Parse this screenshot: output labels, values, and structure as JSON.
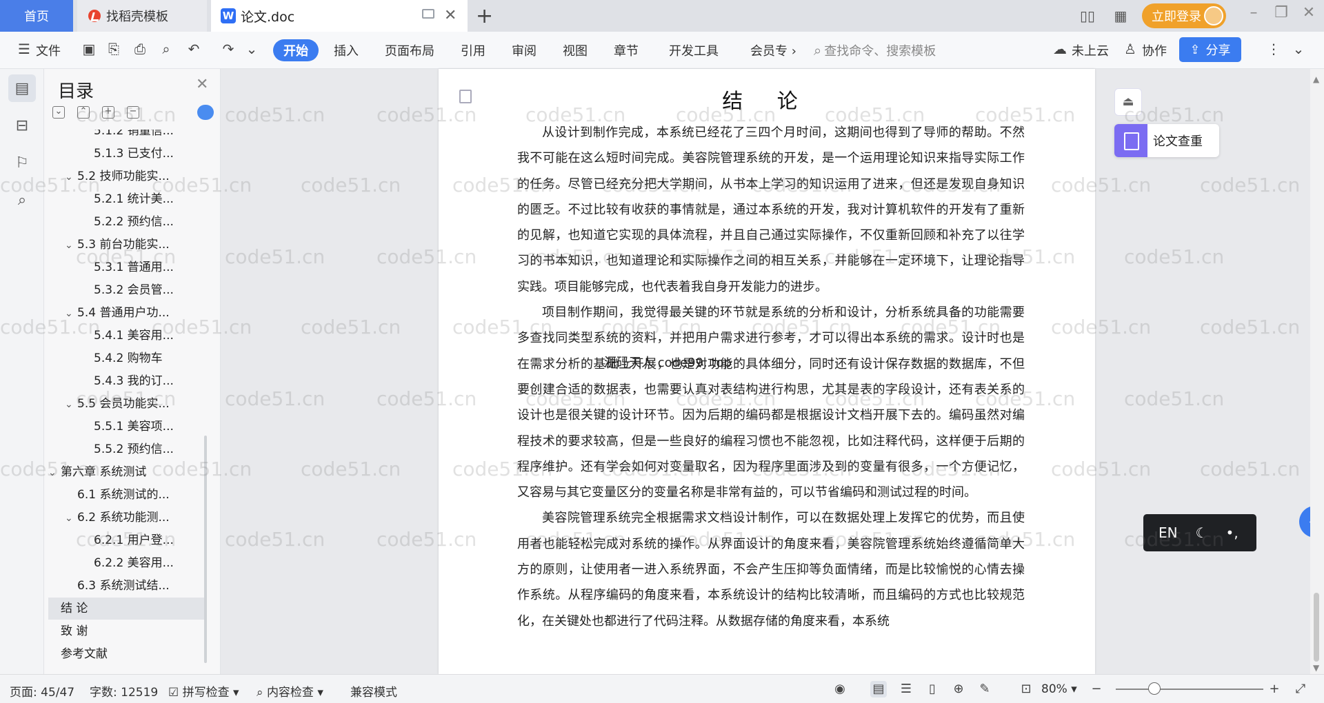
{
  "tabs": {
    "home": "首页",
    "template": "找稻壳模板",
    "doc": "论文.doc"
  },
  "header": {
    "login_label": "立即登录"
  },
  "ribbon": {
    "file": "文件",
    "start": "开始",
    "insert": "插入",
    "layout": "页面布局",
    "reference": "引用",
    "review": "审阅",
    "view": "视图",
    "chapter": "章节",
    "devtools": "开发工具",
    "member": "会员专",
    "search_placeholder": "查找命令、搜索模板",
    "cloud": "未上云",
    "collab": "协作",
    "share": "分享"
  },
  "toc": {
    "title": "目录",
    "items": [
      {
        "text": "5.1.2 销量信...",
        "level": 3
      },
      {
        "text": "5.1.3 已支付...",
        "level": 3
      },
      {
        "text": "5.2 技师功能实...",
        "level": 2
      },
      {
        "text": "5.2.1 统计美...",
        "level": 3
      },
      {
        "text": "5.2.2 预约信...",
        "level": 3
      },
      {
        "text": "5.3 前台功能实...",
        "level": 2
      },
      {
        "text": "5.3.1 普通用...",
        "level": 3
      },
      {
        "text": "5.3.2 会员管...",
        "level": 3
      },
      {
        "text": "5.4 普通用户功...",
        "level": 2
      },
      {
        "text": "5.4.1 美容用...",
        "level": 3
      },
      {
        "text": "5.4.2 购物车",
        "level": 3
      },
      {
        "text": "5.4.3 我的订...",
        "level": 3
      },
      {
        "text": "5.5 会员功能实...",
        "level": 2
      },
      {
        "text": "5.5.1 美容项...",
        "level": 3
      },
      {
        "text": "5.5.2 预约信...",
        "level": 3
      },
      {
        "text": "第六章 系统测试",
        "level": 1
      },
      {
        "text": "6.1 系统测试的...",
        "level": 2
      },
      {
        "text": "6.2 系统功能测...",
        "level": 2
      },
      {
        "text": "6.2.1 用户登...",
        "level": 3
      },
      {
        "text": "6.2.2 美容用...",
        "level": 3
      },
      {
        "text": "6.3 系统测试结...",
        "level": 2
      },
      {
        "text": "结  论",
        "level": 1,
        "selected": true
      },
      {
        "text": "致  谢",
        "level": 1
      },
      {
        "text": "参考文献",
        "level": 1
      }
    ]
  },
  "document": {
    "title": "结 论",
    "paragraphs": [
      "从设计到制作完成，本系统已经花了三四个月时间，这期间也得到了导师的帮助。不然我不可能在这么短时间完成。美容院管理系统的开发，是一个运用理论知识来指导实际工作的任务。尽管已经充分把大学期间，从书本上学习的知识运用了进来，但还是发现自身知识的匮乏。不过比较有收获的事情就是，通过本系统的开发，我对计算机软件的开发有了重新的见解，也知道它实现的具体流程，并且自己通过实际操作，不仅重新回顾和补充了以往学习的书本知识，也知道理论和实际操作之间的相互关系，并能够在一定环境下，让理论指导实践。项目能够完成，也代表着我自身开发能力的进步。",
      "项目制作期间，我觉得最关键的环节就是系统的分析和设计，分析系统具备的功能需要多查找同类型系统的资料，并把用户需求进行参考，才可以得出本系统的需求。设计时也是在需求分析的基础上开展，也是对功能的具体细分，同时还有设计保存数据的数据库，不但要创建合适的数据表，也需要认真对表结构进行构思，尤其是表的字段设计，还有表关系的设计也是很关键的设计环节。因为后期的编码都是根据设计文档开展下去的。编码虽然对编程技术的要求较高，但是一些良好的编程习惯也不能忽视，比如注释代码，这样便于后期的程序维护。还有学会如何对变量取名，因为程序里面涉及到的变量有很多，一个方便记忆，又容易与其它变量区分的变量名称是非常有益的，可以节省编码和测试过程的时间。",
      "美容院管理系统完全根据需求文档设计制作，可以在数据处理上发挥它的优势，而且使用者也能轻松完成对系统的操作。从界面设计的角度来看，美容院管理系统始终遵循简单大方的原则，让使用者一进入系统界面，不会产生压抑等负面情绪，而是比较愉悦的心情去操作系统。从程序编码的角度来看，本系统设计的结构比较清晰，而且编码的方式也比较规范化，在关键处也都进行了代码注释。从数据存储的角度来看，本系统"
    ],
    "overlay_text": "源码天人 code99. top"
  },
  "right_panel": {
    "check_label": "论文查重"
  },
  "ime": {
    "lang": "EN"
  },
  "status": {
    "page": "页面: 45/47",
    "words": "字数: 12519",
    "spell": "拼写检查",
    "content": "内容检查",
    "compat": "兼容模式",
    "zoom": "80%"
  },
  "zoom_level": 0.8,
  "watermark": "code51.cn",
  "colors": {
    "accent": "#3b7cf0",
    "home_tab": "#4a7ee8",
    "login": "#f0a12a"
  }
}
